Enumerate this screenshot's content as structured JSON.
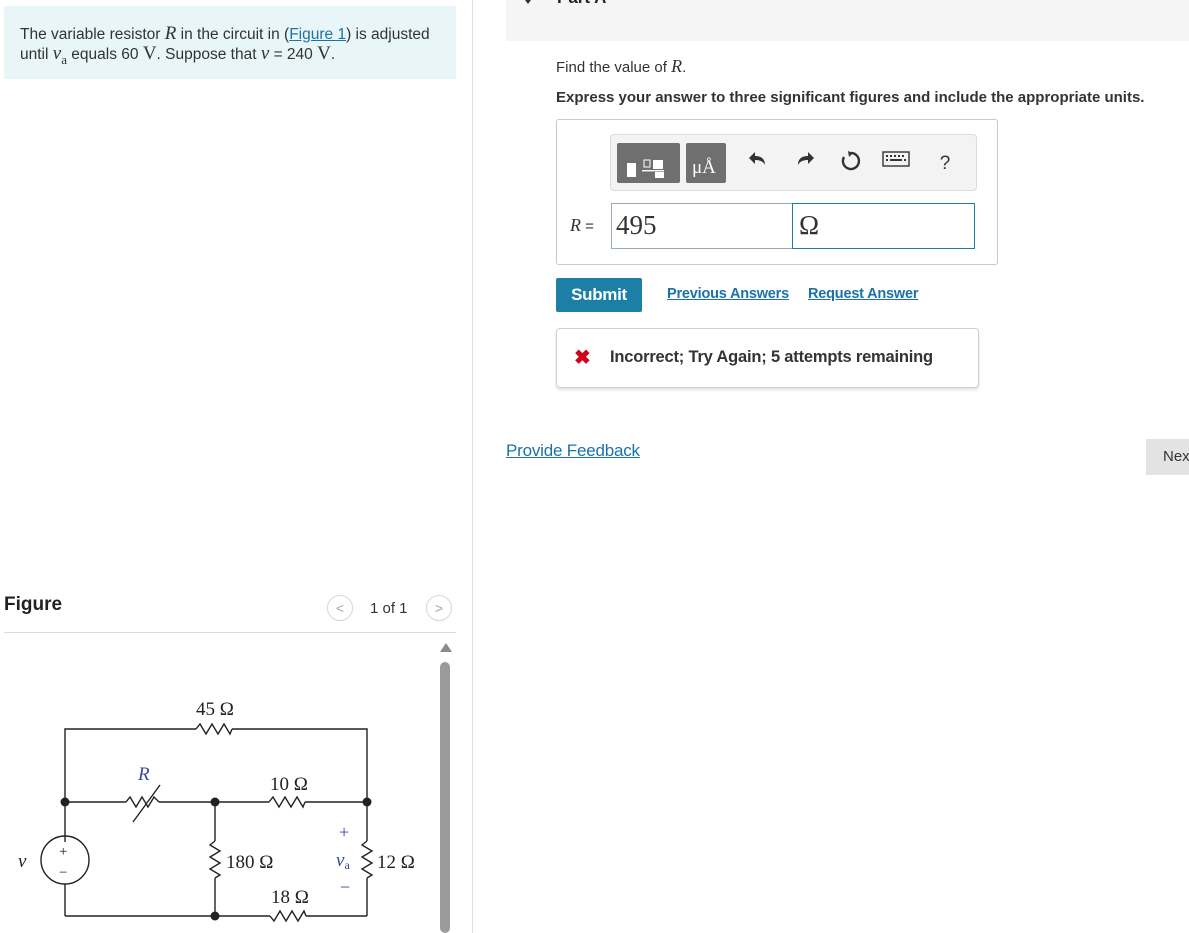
{
  "problem": {
    "text_1": "The variable resistor ",
    "var_R": "R",
    "text_2": " in the circuit in (",
    "figure_link": "Figure 1",
    "text_3": ") is adjusted until ",
    "var_va": "v",
    "var_va_sub": "a",
    "text_4": " equals 60 ",
    "unit_V1": "V",
    "text_5": ". Suppose that ",
    "var_v": "v",
    "text_6": " = 240 ",
    "unit_V2": "V",
    "text_7": "."
  },
  "figure": {
    "title": "Figure",
    "pager": "1 of 1",
    "prev_icon": "chevron-left-icon",
    "next_icon": "chevron-right-icon",
    "circuit": {
      "r_top": "45 Ω",
      "r_variable": "R",
      "r_mid": "10 Ω",
      "r_left": "180 Ω",
      "r_bottom": "18 Ω",
      "r_right": "12 Ω",
      "source": "v",
      "source_plus": "+",
      "source_minus": "−",
      "va_label": "v",
      "va_sub": "a",
      "va_plus": "+",
      "va_minus": "−"
    }
  },
  "part": {
    "title": "Part A",
    "find_prefix": "Find the value of ",
    "find_var": "R",
    "find_suffix": ".",
    "express": "Express your answer to three significant figures and include the appropriate units."
  },
  "answer": {
    "label_var": "R",
    "label_eq": " = ",
    "value": "495",
    "unit": "Ω",
    "toolbar": {
      "units_label": "μÅ",
      "help_label": "?",
      "icons": [
        "templates-icon",
        "units-icon",
        "undo-icon",
        "redo-icon",
        "reset-icon",
        "keyboard-icon",
        "help-icon"
      ]
    }
  },
  "actions": {
    "submit": "Submit",
    "previous_answers": "Previous Answers",
    "request_answer": "Request Answer"
  },
  "feedback": {
    "icon": "x-icon",
    "mark": "✖",
    "message": "Incorrect; Try Again; 5 attempts remaining"
  },
  "footer": {
    "provide_feedback": "Provide Feedback",
    "next": "Next"
  },
  "colors": {
    "problem_bg": "#e8f6f8",
    "link": "#1a73a8",
    "submit_bg": "#1b7fa6",
    "error": "#d0021b"
  }
}
